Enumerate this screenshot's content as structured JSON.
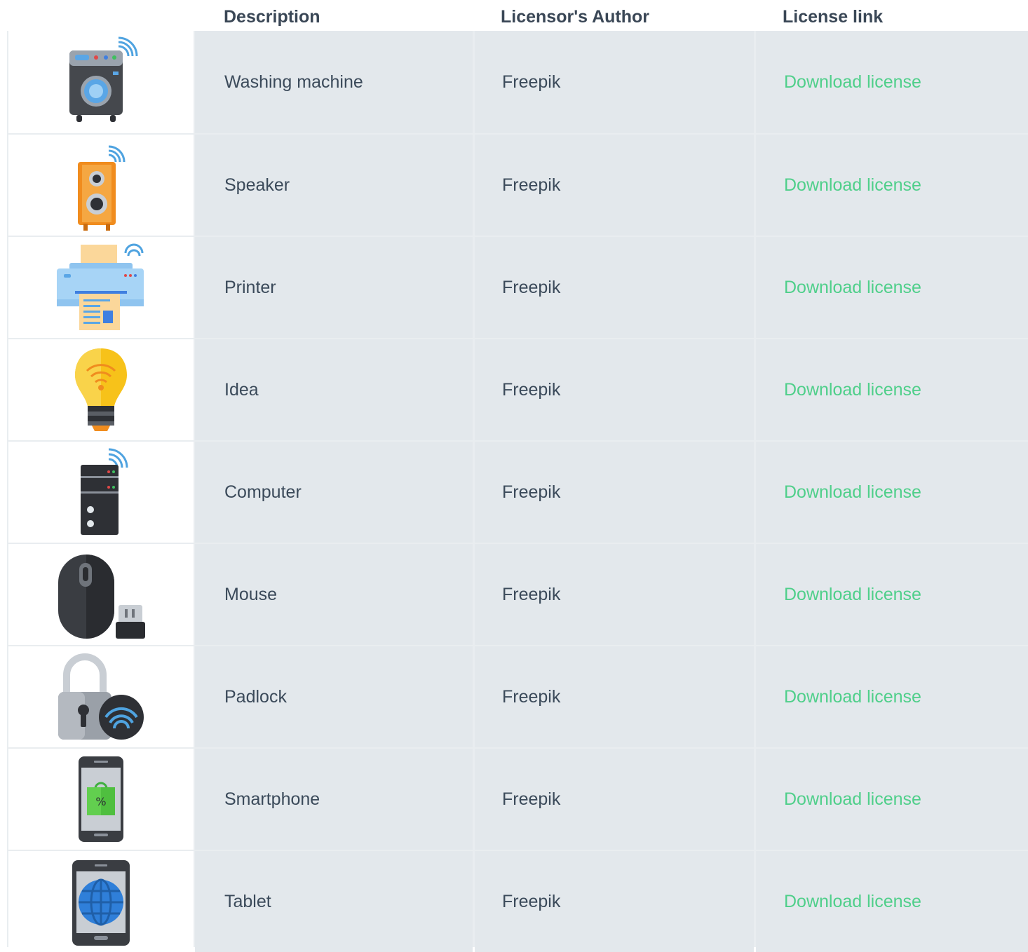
{
  "table": {
    "headers": {
      "description": "Description",
      "author": "Licensor's Author",
      "link": "License link"
    },
    "rows": [
      {
        "icon": "washing-machine-icon",
        "description": "Washing machine",
        "author": "Freepik",
        "link": "Download license"
      },
      {
        "icon": "speaker-icon",
        "description": "Speaker",
        "author": "Freepik",
        "link": "Download license"
      },
      {
        "icon": "printer-icon",
        "description": "Printer",
        "author": "Freepik",
        "link": "Download license"
      },
      {
        "icon": "lightbulb-icon",
        "description": "Idea",
        "author": "Freepik",
        "link": "Download license"
      },
      {
        "icon": "computer-tower-icon",
        "description": "Computer",
        "author": "Freepik",
        "link": "Download license"
      },
      {
        "icon": "mouse-icon",
        "description": "Mouse",
        "author": "Freepik",
        "link": "Download license"
      },
      {
        "icon": "padlock-icon",
        "description": "Padlock",
        "author": "Freepik",
        "link": "Download license"
      },
      {
        "icon": "smartphone-icon",
        "description": "Smartphone",
        "author": "Freepik",
        "link": "Download license"
      },
      {
        "icon": "tablet-icon",
        "description": "Tablet",
        "author": "Freepik",
        "link": "Download license"
      }
    ]
  },
  "colors": {
    "link": "#4fcf8a",
    "cell_bg": "#e3e8ec",
    "text": "#3b4a5a"
  }
}
